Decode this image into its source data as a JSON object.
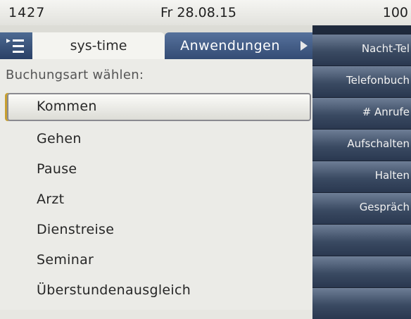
{
  "status": {
    "time": "1427",
    "date": "Fr 28.08.15",
    "extension": "100"
  },
  "tabs": {
    "active": "sys-time",
    "inactive": "Anwendungen"
  },
  "icons": {
    "menu": "menu-list-icon",
    "next": "arrow-right-icon"
  },
  "prompt": "Buchungsart wählen:",
  "items": [
    {
      "label": "Kommen",
      "selected": true
    },
    {
      "label": "Gehen"
    },
    {
      "label": "Pause"
    },
    {
      "label": "Arzt"
    },
    {
      "label": "Dienstreise"
    },
    {
      "label": "Seminar"
    },
    {
      "label": "Überstundenausgleich"
    }
  ],
  "function_keys": [
    "Nacht-Tel",
    "Telefonbuch",
    "# Anrufe",
    "Aufschalten",
    "Halten",
    "Gespräch",
    "",
    "",
    ""
  ],
  "colors": {
    "tab_inactive": "#3f5a84",
    "key_background": "#2a3850",
    "selection_border": "#8a8a90"
  }
}
